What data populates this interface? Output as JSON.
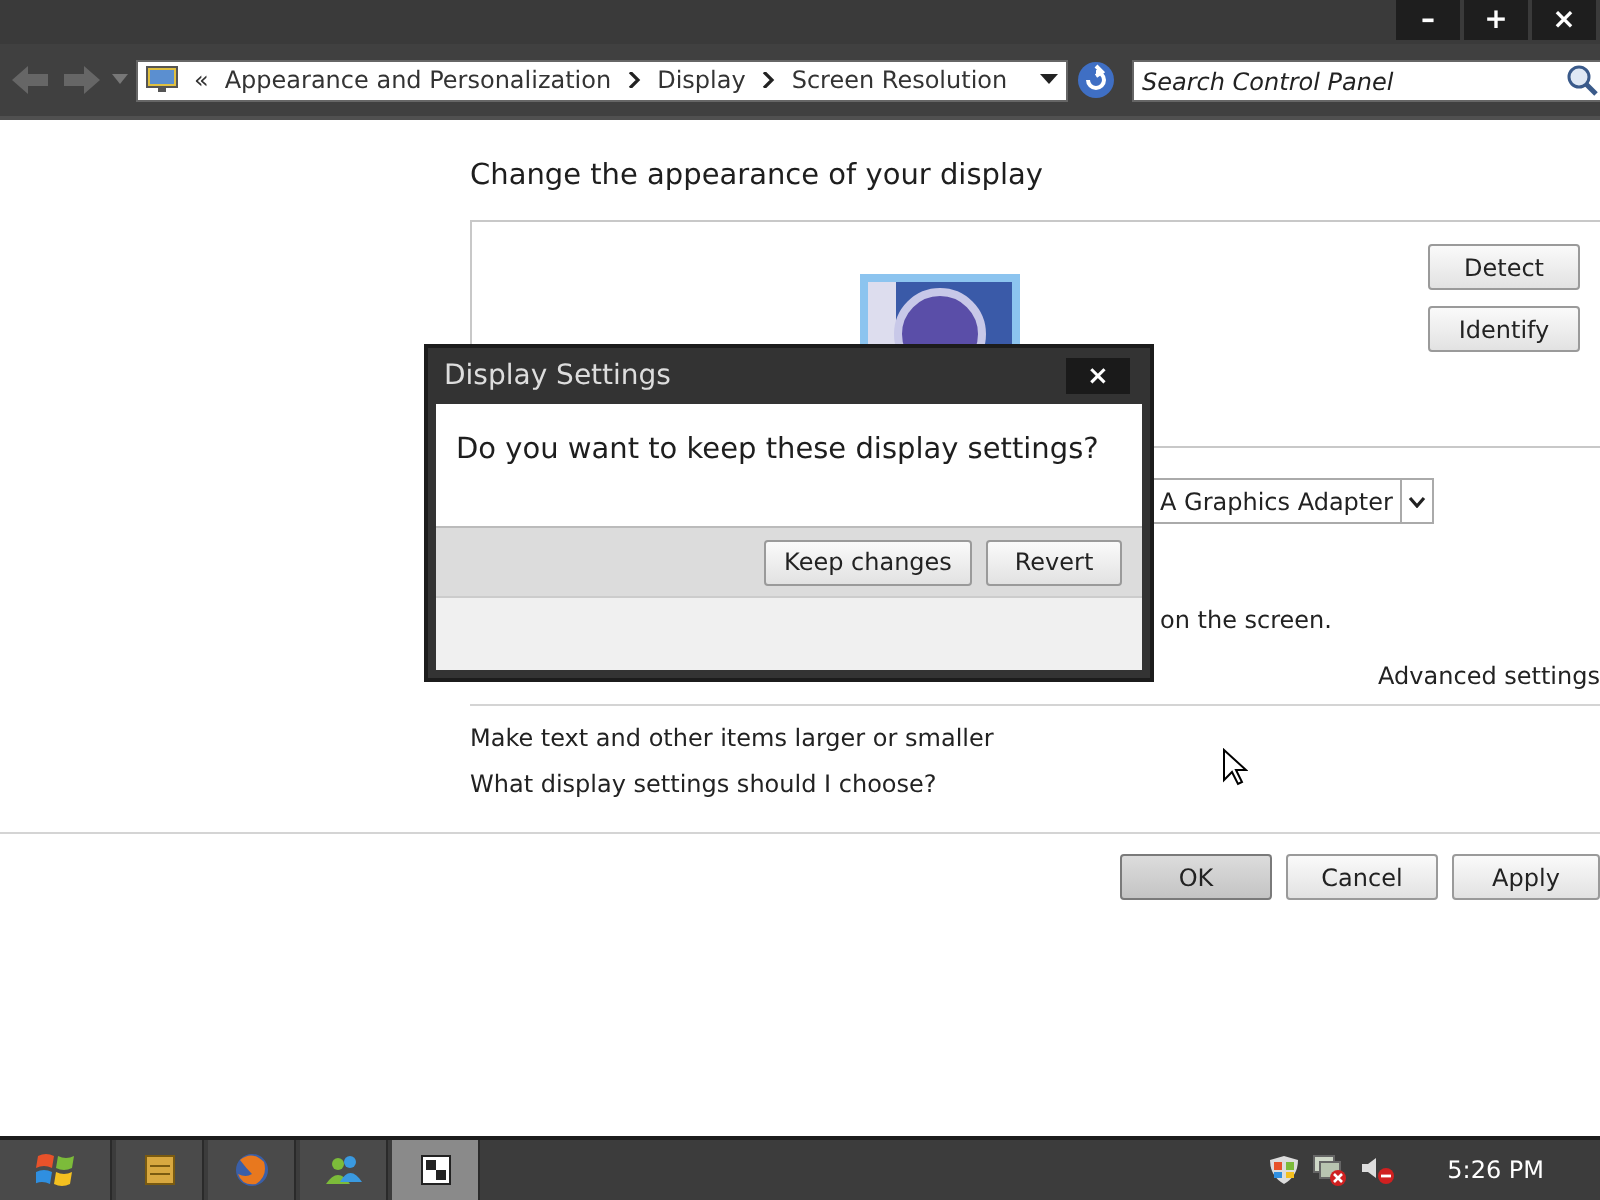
{
  "window": {
    "controls": [
      "–",
      "+",
      "×"
    ]
  },
  "address_bar": {
    "overflow": "«",
    "breadcrumb": [
      "Appearance and Personalization",
      "Display",
      "Screen Resolution"
    ]
  },
  "search": {
    "placeholder": "Search Control Panel"
  },
  "content": {
    "heading": "Change the appearance of your display",
    "detect": "Detect",
    "identify": "Identify",
    "display_dropdown": "A Graphics Adapter",
    "orientation_note": "on the screen.",
    "advanced_link": "Advanced settings",
    "links": [
      "Make text and other items larger or smaller",
      "What display settings should I choose?"
    ]
  },
  "buttons": [
    {
      "label": "OK",
      "default": true
    },
    {
      "label": "Cancel",
      "default": false
    },
    {
      "label": "Apply",
      "default": false
    }
  ],
  "dialog": {
    "title": "Display Settings",
    "close": "×",
    "message": "Do you want to keep these display settings?",
    "buttons": [
      "Keep changes",
      "Revert"
    ]
  },
  "taskbar": {
    "items": [
      {
        "kind": "start",
        "selected": false
      },
      {
        "kind": "cabinet",
        "selected": false
      },
      {
        "kind": "browser",
        "selected": false
      },
      {
        "kind": "people",
        "selected": false
      },
      {
        "kind": "display",
        "selected": true
      }
    ],
    "tray": [
      {
        "kind": "shield"
      },
      {
        "kind": "network"
      },
      {
        "kind": "speaker"
      }
    ],
    "clock": "5:26 PM"
  }
}
